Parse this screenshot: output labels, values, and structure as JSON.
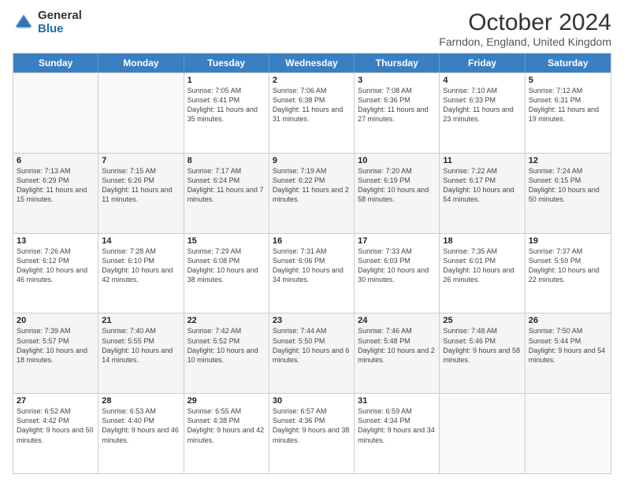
{
  "logo": {
    "general": "General",
    "blue": "Blue"
  },
  "title": "October 2024",
  "location": "Farndon, England, United Kingdom",
  "days_of_week": [
    "Sunday",
    "Monday",
    "Tuesday",
    "Wednesday",
    "Thursday",
    "Friday",
    "Saturday"
  ],
  "weeks": [
    [
      {
        "day": "",
        "sunrise": "",
        "sunset": "",
        "daylight": ""
      },
      {
        "day": "",
        "sunrise": "",
        "sunset": "",
        "daylight": ""
      },
      {
        "day": "1",
        "sunrise": "Sunrise: 7:05 AM",
        "sunset": "Sunset: 6:41 PM",
        "daylight": "Daylight: 11 hours and 35 minutes."
      },
      {
        "day": "2",
        "sunrise": "Sunrise: 7:06 AM",
        "sunset": "Sunset: 6:38 PM",
        "daylight": "Daylight: 11 hours and 31 minutes."
      },
      {
        "day": "3",
        "sunrise": "Sunrise: 7:08 AM",
        "sunset": "Sunset: 6:36 PM",
        "daylight": "Daylight: 11 hours and 27 minutes."
      },
      {
        "day": "4",
        "sunrise": "Sunrise: 7:10 AM",
        "sunset": "Sunset: 6:33 PM",
        "daylight": "Daylight: 11 hours and 23 minutes."
      },
      {
        "day": "5",
        "sunrise": "Sunrise: 7:12 AM",
        "sunset": "Sunset: 6:31 PM",
        "daylight": "Daylight: 11 hours and 19 minutes."
      }
    ],
    [
      {
        "day": "6",
        "sunrise": "Sunrise: 7:13 AM",
        "sunset": "Sunset: 6:29 PM",
        "daylight": "Daylight: 11 hours and 15 minutes."
      },
      {
        "day": "7",
        "sunrise": "Sunrise: 7:15 AM",
        "sunset": "Sunset: 6:26 PM",
        "daylight": "Daylight: 11 hours and 11 minutes."
      },
      {
        "day": "8",
        "sunrise": "Sunrise: 7:17 AM",
        "sunset": "Sunset: 6:24 PM",
        "daylight": "Daylight: 11 hours and 7 minutes."
      },
      {
        "day": "9",
        "sunrise": "Sunrise: 7:19 AM",
        "sunset": "Sunset: 6:22 PM",
        "daylight": "Daylight: 11 hours and 2 minutes."
      },
      {
        "day": "10",
        "sunrise": "Sunrise: 7:20 AM",
        "sunset": "Sunset: 6:19 PM",
        "daylight": "Daylight: 10 hours and 58 minutes."
      },
      {
        "day": "11",
        "sunrise": "Sunrise: 7:22 AM",
        "sunset": "Sunset: 6:17 PM",
        "daylight": "Daylight: 10 hours and 54 minutes."
      },
      {
        "day": "12",
        "sunrise": "Sunrise: 7:24 AM",
        "sunset": "Sunset: 6:15 PM",
        "daylight": "Daylight: 10 hours and 50 minutes."
      }
    ],
    [
      {
        "day": "13",
        "sunrise": "Sunrise: 7:26 AM",
        "sunset": "Sunset: 6:12 PM",
        "daylight": "Daylight: 10 hours and 46 minutes."
      },
      {
        "day": "14",
        "sunrise": "Sunrise: 7:28 AM",
        "sunset": "Sunset: 6:10 PM",
        "daylight": "Daylight: 10 hours and 42 minutes."
      },
      {
        "day": "15",
        "sunrise": "Sunrise: 7:29 AM",
        "sunset": "Sunset: 6:08 PM",
        "daylight": "Daylight: 10 hours and 38 minutes."
      },
      {
        "day": "16",
        "sunrise": "Sunrise: 7:31 AM",
        "sunset": "Sunset: 6:06 PM",
        "daylight": "Daylight: 10 hours and 34 minutes."
      },
      {
        "day": "17",
        "sunrise": "Sunrise: 7:33 AM",
        "sunset": "Sunset: 6:03 PM",
        "daylight": "Daylight: 10 hours and 30 minutes."
      },
      {
        "day": "18",
        "sunrise": "Sunrise: 7:35 AM",
        "sunset": "Sunset: 6:01 PM",
        "daylight": "Daylight: 10 hours and 26 minutes."
      },
      {
        "day": "19",
        "sunrise": "Sunrise: 7:37 AM",
        "sunset": "Sunset: 5:59 PM",
        "daylight": "Daylight: 10 hours and 22 minutes."
      }
    ],
    [
      {
        "day": "20",
        "sunrise": "Sunrise: 7:39 AM",
        "sunset": "Sunset: 5:57 PM",
        "daylight": "Daylight: 10 hours and 18 minutes."
      },
      {
        "day": "21",
        "sunrise": "Sunrise: 7:40 AM",
        "sunset": "Sunset: 5:55 PM",
        "daylight": "Daylight: 10 hours and 14 minutes."
      },
      {
        "day": "22",
        "sunrise": "Sunrise: 7:42 AM",
        "sunset": "Sunset: 5:52 PM",
        "daylight": "Daylight: 10 hours and 10 minutes."
      },
      {
        "day": "23",
        "sunrise": "Sunrise: 7:44 AM",
        "sunset": "Sunset: 5:50 PM",
        "daylight": "Daylight: 10 hours and 6 minutes."
      },
      {
        "day": "24",
        "sunrise": "Sunrise: 7:46 AM",
        "sunset": "Sunset: 5:48 PM",
        "daylight": "Daylight: 10 hours and 2 minutes."
      },
      {
        "day": "25",
        "sunrise": "Sunrise: 7:48 AM",
        "sunset": "Sunset: 5:46 PM",
        "daylight": "Daylight: 9 hours and 58 minutes."
      },
      {
        "day": "26",
        "sunrise": "Sunrise: 7:50 AM",
        "sunset": "Sunset: 5:44 PM",
        "daylight": "Daylight: 9 hours and 54 minutes."
      }
    ],
    [
      {
        "day": "27",
        "sunrise": "Sunrise: 6:52 AM",
        "sunset": "Sunset: 4:42 PM",
        "daylight": "Daylight: 9 hours and 50 minutes."
      },
      {
        "day": "28",
        "sunrise": "Sunrise: 6:53 AM",
        "sunset": "Sunset: 4:40 PM",
        "daylight": "Daylight: 9 hours and 46 minutes."
      },
      {
        "day": "29",
        "sunrise": "Sunrise: 6:55 AM",
        "sunset": "Sunset: 4:38 PM",
        "daylight": "Daylight: 9 hours and 42 minutes."
      },
      {
        "day": "30",
        "sunrise": "Sunrise: 6:57 AM",
        "sunset": "Sunset: 4:36 PM",
        "daylight": "Daylight: 9 hours and 38 minutes."
      },
      {
        "day": "31",
        "sunrise": "Sunrise: 6:59 AM",
        "sunset": "Sunset: 4:34 PM",
        "daylight": "Daylight: 9 hours and 34 minutes."
      },
      {
        "day": "",
        "sunrise": "",
        "sunset": "",
        "daylight": ""
      },
      {
        "day": "",
        "sunrise": "",
        "sunset": "",
        "daylight": ""
      }
    ]
  ]
}
